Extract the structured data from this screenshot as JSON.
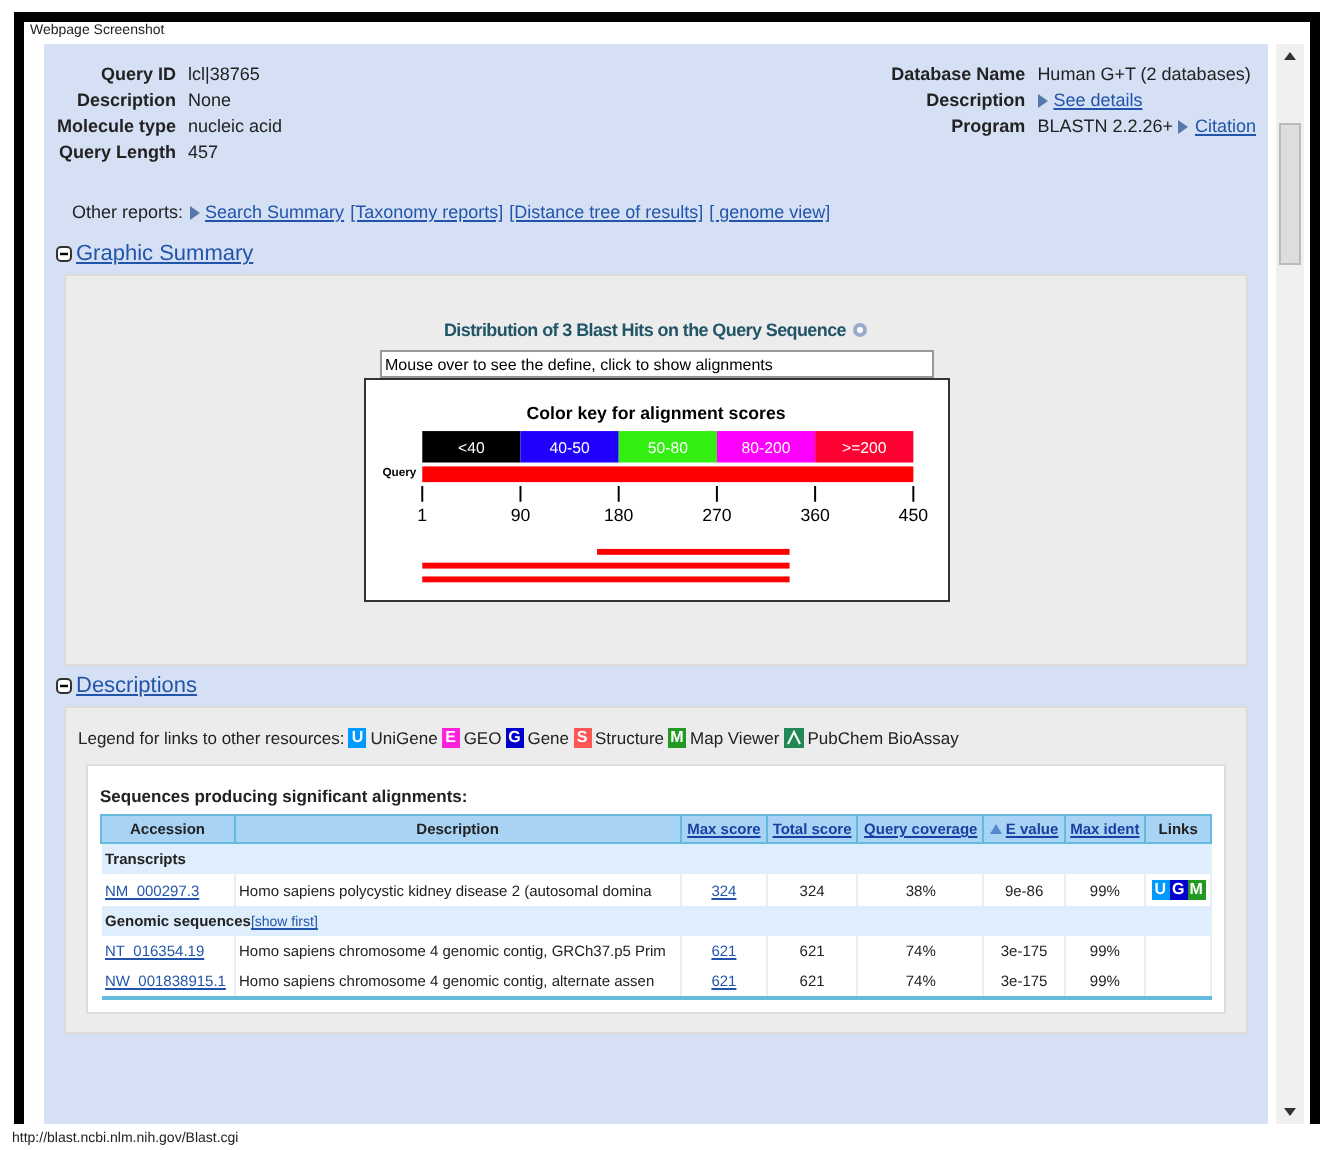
{
  "window": {
    "title": "Webpage Screenshot"
  },
  "query_info": {
    "left": [
      {
        "label": "Query ID",
        "text": "lcl|38765"
      },
      {
        "label": "Description",
        "text": "None"
      },
      {
        "label": "Molecule type",
        "text": "nucleic acid"
      },
      {
        "label": "Query Length",
        "text": "457"
      }
    ],
    "right": [
      {
        "label": "Database Name",
        "text": "Human G+T (2 databases)"
      },
      {
        "label": "Description",
        "link": "See details"
      },
      {
        "label": "Program",
        "text": "BLASTN 2.2.26+",
        "link": "Citation"
      }
    ]
  },
  "other_reports": {
    "label": "Other reports:",
    "links": [
      "Search Summary",
      "[Taxonomy reports]",
      "[Distance tree of results]",
      "[ genome view]"
    ]
  },
  "graphic_summary": {
    "title": "Graphic Summary",
    "expanded": true,
    "heading": "Distribution of 3 Blast Hits on the Query Sequence",
    "hint_field": {
      "value": "Mouse over to see the define, click to show alignments"
    },
    "color_key": {
      "title": "Color key for alignment scores",
      "bins": [
        {
          "label": "<40",
          "color": "#000000"
        },
        {
          "label": "40-50",
          "color": "#2200ff"
        },
        {
          "label": "50-80",
          "color": "#33ee11"
        },
        {
          "label": "80-200",
          "color": "#ff00ff"
        },
        {
          "label": ">=200",
          "color": "#ff0033"
        }
      ],
      "query_label": "Query",
      "ticks": [
        "1",
        "90",
        "180",
        "270",
        "360",
        "450"
      ]
    }
  },
  "descriptions": {
    "title": "Descriptions",
    "expanded": true,
    "legend": {
      "label": "Legend for links to other resources:",
      "items": [
        {
          "kind": "letter",
          "letter": "U",
          "label": "UniGene",
          "color": "#0099ff"
        },
        {
          "kind": "letter",
          "letter": "E",
          "label": "GEO",
          "color": "#ff22dd"
        },
        {
          "kind": "letter",
          "letter": "G",
          "label": "Gene",
          "color": "#0000cc"
        },
        {
          "kind": "letter",
          "letter": "S",
          "label": "Structure",
          "color": "#ff5555"
        },
        {
          "kind": "letter",
          "letter": "M",
          "label": "Map Viewer",
          "color": "#229922"
        },
        {
          "kind": "glyph",
          "label": "PubChem BioAssay",
          "color": "#228855"
        }
      ]
    },
    "table": {
      "caption": "Sequences producing significant alignments:",
      "columns": [
        {
          "label": "Accession",
          "link": false,
          "sorted": false
        },
        {
          "label": "Description",
          "link": false,
          "sorted": false
        },
        {
          "label": "Max score",
          "link": true,
          "sorted": false
        },
        {
          "label": "Total score",
          "link": true,
          "sorted": false
        },
        {
          "label": "Query coverage",
          "link": true,
          "sorted": false
        },
        {
          "label": "E value",
          "link": true,
          "sorted": true
        },
        {
          "label": "Max ident",
          "link": true,
          "sorted": false
        },
        {
          "label": "Links",
          "link": false,
          "sorted": false
        }
      ],
      "groups": [
        {
          "title": "Transcripts",
          "rows": [
            {
              "accession": "NM_000297.3",
              "description": "Homo sapiens polycystic kidney disease 2 (autosomal domina",
              "max_score": "324",
              "total_score": "324",
              "coverage": "38%",
              "e_value": "9e-86",
              "max_ident": "99%",
              "links": [
                {
                  "letter": "U",
                  "color": "#0099ff"
                },
                {
                  "letter": "G",
                  "color": "#0000cc"
                },
                {
                  "letter": "M",
                  "color": "#229922"
                }
              ]
            }
          ]
        },
        {
          "title": "Genomic sequences",
          "action": "[show first]",
          "rows": [
            {
              "accession": "NT_016354.19",
              "description": "Homo sapiens chromosome 4 genomic contig, GRCh37.p5 Prim",
              "max_score": "621",
              "total_score": "621",
              "coverage": "74%",
              "e_value": "3e-175",
              "max_ident": "99%",
              "links": []
            },
            {
              "accession": "NW_001838915.1",
              "description": "Homo sapiens chromosome 4 genomic contig, alternate assen",
              "max_score": "621",
              "total_score": "621",
              "coverage": "74%",
              "e_value": "3e-175",
              "max_ident": "99%",
              "links": []
            }
          ]
        }
      ]
    }
  },
  "status_bar": {
    "url": "http://blast.ncbi.nlm.nih.gov/Blast.cgi"
  }
}
